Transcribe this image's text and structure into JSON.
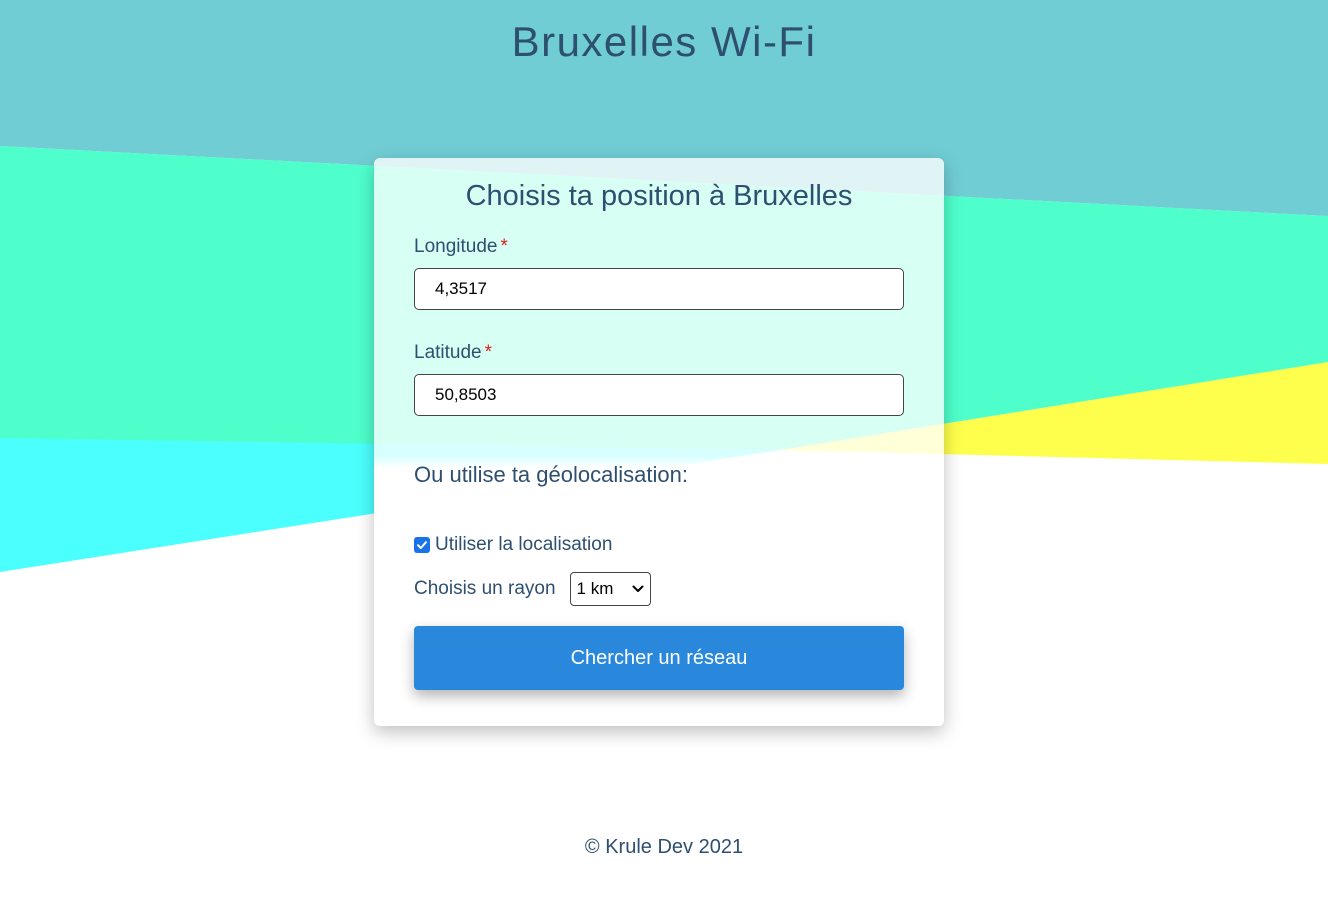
{
  "header": {
    "title": "Bruxelles Wi-Fi"
  },
  "form": {
    "title": "Choisis ta position à Bruxelles",
    "longitude": {
      "label": "Longitude",
      "required_mark": "*",
      "value": "4,3517"
    },
    "latitude": {
      "label": "Latitude",
      "required_mark": "*",
      "value": "50,8503"
    },
    "geo_heading": "Ou utilise ta géolocalisation:",
    "use_location": {
      "label": "Utiliser la localisation",
      "checked": true
    },
    "radius": {
      "label": "Choisis un rayon",
      "selected": "1 km"
    },
    "submit_label": "Chercher un réseau"
  },
  "footer": {
    "text": "© Krule Dev 2021"
  },
  "colors": {
    "top_band": "#70cdd4",
    "green_band": "#4effcc",
    "cyan_band": "#4bfffe",
    "yellow_band": "#feff4c",
    "accent_button": "#2a88dc",
    "checkbox": "#1a73e8",
    "text": "#2e4f70",
    "required": "#e02020"
  },
  "icons": {
    "checkbox": "check-icon",
    "select": "chevron-down-icon"
  }
}
